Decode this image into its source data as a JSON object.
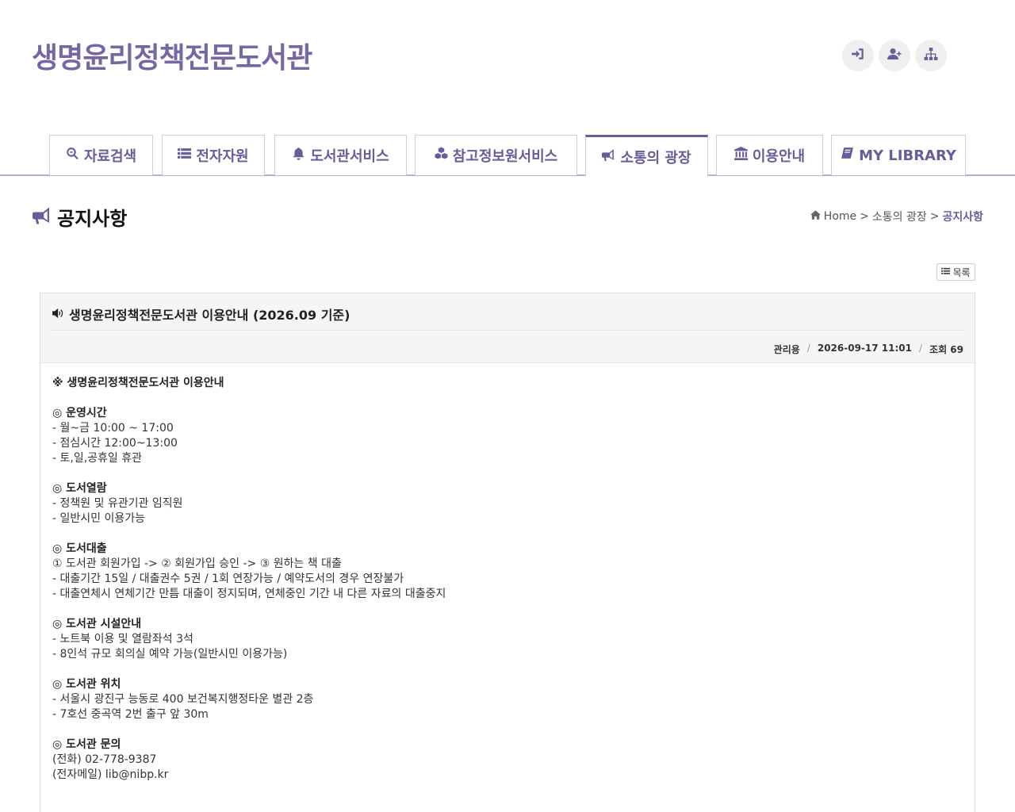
{
  "site": {
    "title": "생명윤리정책전문도서관"
  },
  "top_icons": [
    "login-icon",
    "user-plus-icon",
    "sitemap-icon"
  ],
  "nav": {
    "tabs": [
      {
        "label": "자료검색",
        "icon": "search-icon"
      },
      {
        "label": "전자자원",
        "icon": "list-icon"
      },
      {
        "label": "도서관서비스",
        "icon": "bell-icon"
      },
      {
        "label": "참고정보원서비스",
        "icon": "cubes-icon"
      },
      {
        "label": "소통의 광장",
        "icon": "bullhorn-icon",
        "active": true
      },
      {
        "label": "이용안내",
        "icon": "institution-icon"
      },
      {
        "label": "MY LIBRARY",
        "icon": "book-icon"
      }
    ]
  },
  "page": {
    "title": "공지사항",
    "breadcrumb": {
      "home": "Home",
      "sep": ">",
      "section": "소통의 광장",
      "current": "공지사항"
    },
    "list_button": "목록"
  },
  "article": {
    "title": "생명윤리정책전문도서관 이용안내 (2026.09 기준)",
    "author": "관리용",
    "date": "2026-09-17 11:01",
    "views": "조회 69",
    "meta_sep": "/",
    "body": [
      {
        "text": "※ 생명윤리정책전문도서관 이용안내",
        "bold": true
      },
      {
        "text": ""
      },
      {
        "text": "◎ 운영시간",
        "bold": true
      },
      {
        "text": "- 월~금 10:00 ~ 17:00"
      },
      {
        "text": "- 점심시간 12:00~13:00"
      },
      {
        "text": "- 토,일,공휴일 휴관"
      },
      {
        "text": ""
      },
      {
        "text": "◎ 도서열람",
        "bold": true
      },
      {
        "text": "- 정책원 및 유관기관 임직원"
      },
      {
        "text": "- 일반시민 이용가능"
      },
      {
        "text": ""
      },
      {
        "text": "◎ 도서대출",
        "bold": true
      },
      {
        "text": "① 도서관 회원가입 -> ② 회원가입 승인 -> ③ 원하는 책 대출"
      },
      {
        "text": "- 대출기간 15일 / 대출권수 5권 / 1회 연장가능 / 예약도서의 경우 연장불가"
      },
      {
        "text": "- 대출연체시 연체기간 만틈 대출이 정지되며, 연체중인 기간 내 다른 자료의 대출중지"
      },
      {
        "text": ""
      },
      {
        "text": "◎ 도서관 시설안내",
        "bold": true
      },
      {
        "text": "- 노트북 이용 및 열람좌석 3석"
      },
      {
        "text": "- 8인석 규모 회의실 예약 가능(일반시민 이용가능)"
      },
      {
        "text": ""
      },
      {
        "text": "◎ 도서관 위치",
        "bold": true
      },
      {
        "text": "- 서울시 광진구 능동로 400 보건복지행정타운 별관 2층"
      },
      {
        "text": "- 7호선 중곡역 2번 출구 앞 30m"
      },
      {
        "text": ""
      },
      {
        "text": "◎ 도서관 문의",
        "bold": true
      },
      {
        "text": "(전화) 02-778-9387"
      },
      {
        "text": "(전자메일) lib@nibp.kr"
      }
    ]
  },
  "colors": {
    "accent": "#6a5b9a",
    "title": "#7667a4",
    "border": "#cfcfd6"
  }
}
